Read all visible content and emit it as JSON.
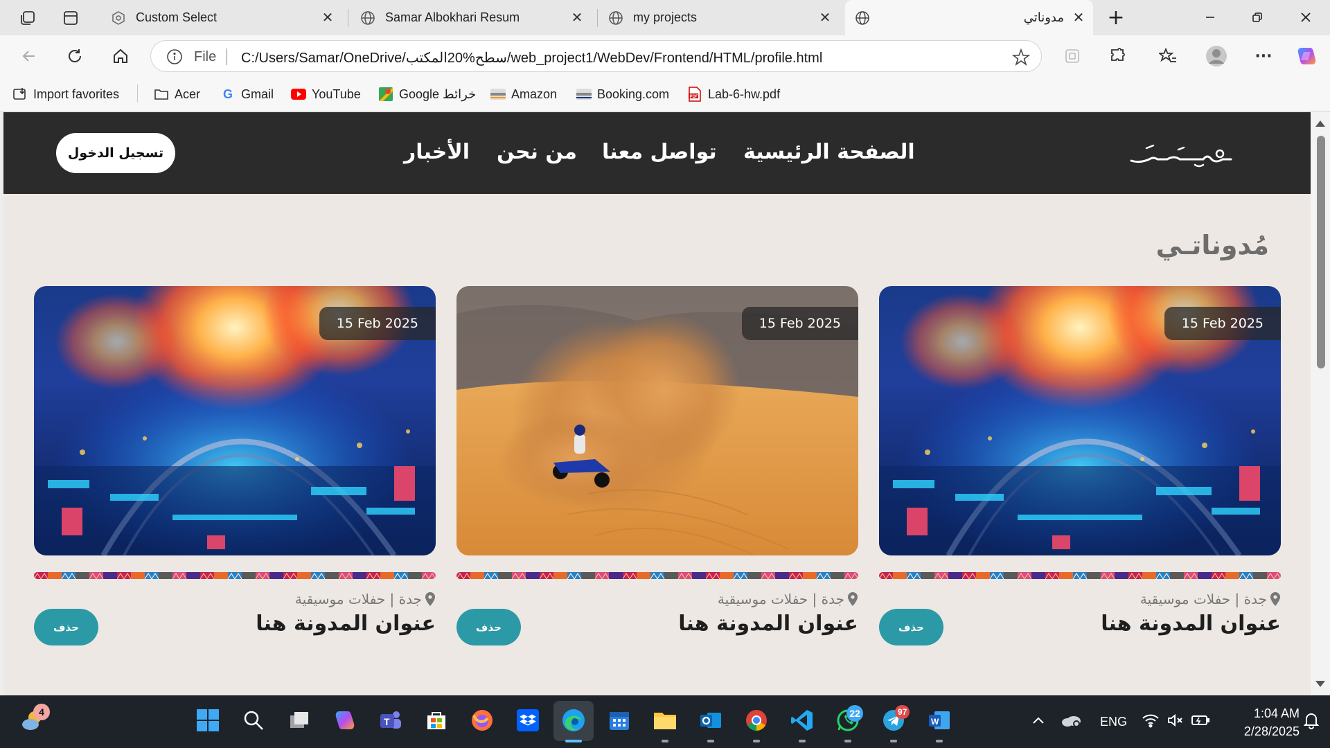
{
  "browser": {
    "tabs": [
      {
        "title": "Custom Select",
        "icon": "custom-select-favicon"
      },
      {
        "title": "Samar Albokhari Resum",
        "icon": "globe-icon"
      },
      {
        "title": "my projects",
        "icon": "globe-icon"
      },
      {
        "title": "مدوناتي",
        "icon": "globe-icon",
        "active": true
      }
    ],
    "address": {
      "scheme_label": "File",
      "url": "C:/Users/Samar/OneDrive/سطح%20المكتب/web_project1/WebDev/Frontend/HTML/profile.html"
    },
    "bookmarks": [
      {
        "label": "Import favorites",
        "icon": "import-icon"
      },
      {
        "label": "Acer",
        "icon": "folder-icon"
      },
      {
        "label": "Gmail",
        "icon": "google-icon"
      },
      {
        "label": "YouTube",
        "icon": "youtube-icon"
      },
      {
        "label": "Google خرائط",
        "icon": "maps-icon"
      },
      {
        "label": "Amazon",
        "icon": "amazon-icon"
      },
      {
        "label": "Booking.com",
        "icon": "booking-icon"
      },
      {
        "label": "Lab-6-hw.pdf",
        "icon": "pdf-icon"
      }
    ]
  },
  "site": {
    "login_label": "تسجيل الدخول",
    "nav": [
      "الصفحة الرئيسية",
      "تواصل معنا",
      "من نحن",
      "الأخبار"
    ],
    "page_title": "مُدوناتـي",
    "cards": [
      {
        "date": "15 Feb 2025",
        "location": "جدة | حفلات موسيقية",
        "title": "عنوان المدونة هنا",
        "delete_label": "حذف",
        "image": "festival-night"
      },
      {
        "date": "15 Feb 2025",
        "location": "جدة | حفلات موسيقية",
        "title": "عنوان المدونة هنا",
        "delete_label": "حذف",
        "image": "desert-quad-bike"
      },
      {
        "date": "15 Feb 2025",
        "location": "جدة | حفلات موسيقية",
        "title": "عنوان المدونة هنا",
        "delete_label": "حذف",
        "image": "festival-night"
      }
    ],
    "colors": {
      "header": "#2b2b2b",
      "page_bg": "#ede8e3",
      "delete_button": "#2b9aa6"
    }
  },
  "taskbar": {
    "weather_badge": "4",
    "whatsapp_badge": "22",
    "telegram_badge": "97",
    "language": "ENG",
    "time": "1:04 AM",
    "date": "2/28/2025"
  }
}
